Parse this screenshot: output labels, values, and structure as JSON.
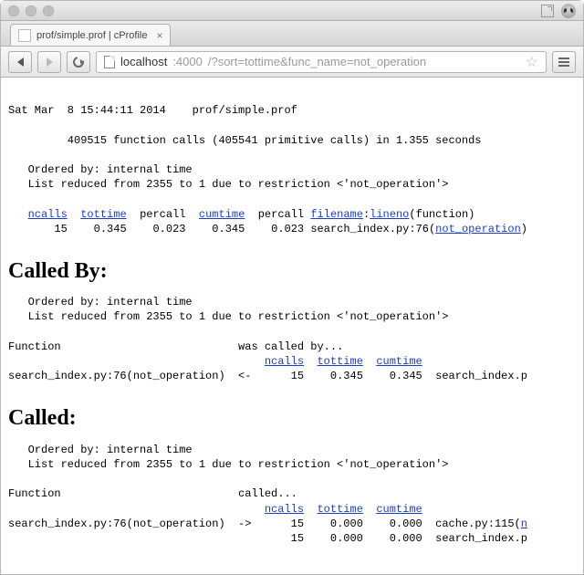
{
  "tab": {
    "title": "prof/simple.prof | cProfile"
  },
  "url": {
    "host": "localhost",
    "port": ":4000",
    "path": "/?sort=tottime&func_name=not_operation"
  },
  "header": {
    "date_line": "Sat Mar  8 15:44:11 2014    prof/simple.prof",
    "calls_line": "         409515 function calls (405541 primitive calls) in 1.355 seconds",
    "ordered_line": "   Ordered by: internal time",
    "reduced_line": "   List reduced from 2355 to 1 due to restriction <'not_operation'>"
  },
  "cols": {
    "ncalls": "ncalls",
    "tottime": "tottime",
    "percall": "percall",
    "cumtime": "cumtime",
    "filename": "filename",
    "lineno": "lineno",
    "function_suffix": "(function)"
  },
  "row": {
    "ncalls": "15",
    "tottime": "0.345",
    "percall1": "0.023",
    "cumtime": "0.345",
    "percall2": "0.023",
    "file_pre": "search_index.py:76(",
    "func": "not_operation",
    "file_post": ")"
  },
  "called_by": {
    "heading": "Called By:",
    "ordered_line": "   Ordered by: internal time",
    "reduced_line": "   List reduced from 2355 to 1 due to restriction <'not_operation'>",
    "col_function": "Function",
    "col_was_called": "was called by...",
    "func_label": "search_index.py:76(not_operation)",
    "arrow": "<-",
    "ncalls": "15",
    "tottime": "0.345",
    "cumtime": "0.345",
    "caller": "search_index.p"
  },
  "called": {
    "heading": "Called:",
    "ordered_line": "   Ordered by: internal time",
    "reduced_line": "   List reduced from 2355 to 1 due to restriction <'not_operation'>",
    "col_function": "Function",
    "col_called": "called...",
    "func_label": "search_index.py:76(not_operation)",
    "arrow": "->",
    "r1": {
      "ncalls": "15",
      "tottime": "0.000",
      "cumtime": "0.000",
      "callee_pre": "cache.py:115(",
      "callee_link": "n"
    },
    "r2": {
      "ncalls": "15",
      "tottime": "0.000",
      "cumtime": "0.000",
      "callee": "search_index.p"
    }
  },
  "chart_data": {
    "type": "table",
    "title": "cProfile stats filtered to not_operation",
    "main": {
      "columns": [
        "ncalls",
        "tottime",
        "percall",
        "cumtime",
        "percall",
        "filename:lineno(function)"
      ],
      "rows": [
        {
          "ncalls": 15,
          "tottime": 0.345,
          "percall_tot": 0.023,
          "cumtime": 0.345,
          "percall_cum": 0.023,
          "location": "search_index.py:76(not_operation)"
        }
      ]
    },
    "called_by": {
      "columns": [
        "function",
        "ncalls",
        "tottime",
        "cumtime",
        "caller"
      ],
      "rows": [
        {
          "function": "search_index.py:76(not_operation)",
          "ncalls": 15,
          "tottime": 0.345,
          "cumtime": 0.345,
          "caller": "search_index.p…"
        }
      ]
    },
    "called": {
      "columns": [
        "function",
        "ncalls",
        "tottime",
        "cumtime",
        "callee"
      ],
      "rows": [
        {
          "function": "search_index.py:76(not_operation)",
          "ncalls": 15,
          "tottime": 0.0,
          "cumtime": 0.0,
          "callee": "cache.py:115(…)"
        },
        {
          "function": "",
          "ncalls": 15,
          "tottime": 0.0,
          "cumtime": 0.0,
          "callee": "search_index.p…"
        }
      ]
    }
  }
}
